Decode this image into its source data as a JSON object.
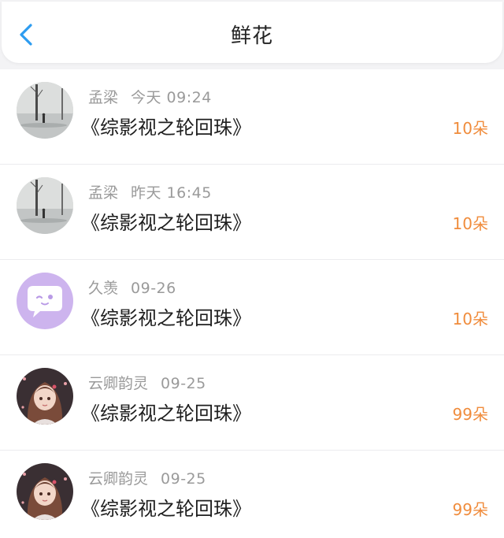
{
  "header": {
    "title": "鲜花",
    "back_icon": "chevron-left-icon",
    "accent": "#2d9cf0"
  },
  "colors": {
    "amount": "#f08c3c",
    "meta": "#9a9a9a"
  },
  "records": [
    {
      "user": "孟梁",
      "time": "今天 09:24",
      "book": "《综影视之轮回珠》",
      "amount": "10朵",
      "avatar": "misty-lake-avatar"
    },
    {
      "user": "孟梁",
      "time": "昨天 16:45",
      "book": "《综影视之轮回珠》",
      "amount": "10朵",
      "avatar": "misty-lake-avatar"
    },
    {
      "user": "久羡",
      "time": "09-26",
      "book": "《综影视之轮回珠》",
      "amount": "10朵",
      "avatar": "purple-chat-bubble-avatar"
    },
    {
      "user": "云卿韵灵",
      "time": "09-25",
      "book": "《综影视之轮回珠》",
      "amount": "99朵",
      "avatar": "anime-girl-avatar"
    },
    {
      "user": "云卿韵灵",
      "time": "09-25",
      "book": "《综影视之轮回珠》",
      "amount": "99朵",
      "avatar": "anime-girl-avatar"
    }
  ]
}
